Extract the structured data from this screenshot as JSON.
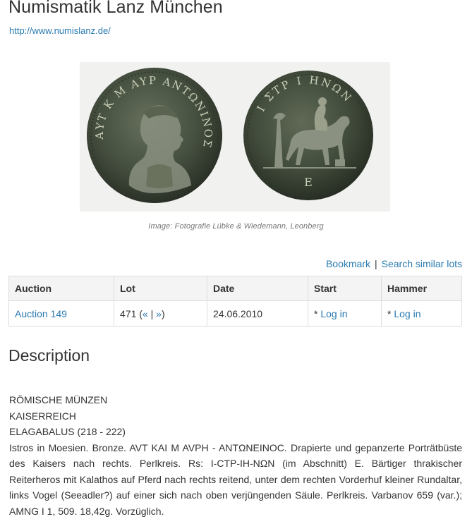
{
  "header": {
    "title": "Numismatik Lanz München",
    "site_url": "http://www.numislanz.de/"
  },
  "image": {
    "obverse_legend": "ΑΥΤ Κ Μ ΑΥΡ ΑΝΤΩΝΙΝΟΣ",
    "reverse_legend": "Ι ΣΤΡ Ι ΗΝΩΝ",
    "exergue": "Ε",
    "caption": "Image: Fotografie Lübke & Wiedemann, Leonberg"
  },
  "actions": {
    "bookmark": "Bookmark",
    "separator": "|",
    "search_similar": "Search similar lots"
  },
  "table": {
    "headers": [
      "Auction",
      "Lot",
      "Date",
      "Start",
      "Hammer"
    ],
    "row": {
      "auction": "Auction 149",
      "lot_number": "471",
      "lot_open": "(",
      "lot_prev": "«",
      "lot_sep": "|",
      "lot_next": "»",
      "lot_close": ")",
      "date": "24.06.2010",
      "start_prefix": "*",
      "start_login": "Log in",
      "hammer_prefix": "*",
      "hammer_login": "Log in"
    }
  },
  "description": {
    "heading": "Description",
    "lines": [
      "RÖMISCHE MÜNZEN",
      "KAISERREICH",
      "ELAGABALUS (218 - 222)"
    ],
    "body": "Istros in Moesien. Bronze. AVT KAI M AVPH - ANTΩNEINOC. Drapierte und gepanzerte Porträtbüste des Kaisers nach rechts. Perlkreis. Rs: I-CTP-IH-NΩN (im Abschnitt) E. Bärtiger thrakischer Reiterheros mit Kalathos auf Pferd nach rechts reitend, unter dem rechten Vorderhuf kleiner Rundaltar, links Vogel (Seeadler?) auf einer sich nach oben verjüngenden Säule. Perlkreis. Varbanov 659 (var.); AMNG I 1, 509. 18,42g. Vorzüglich."
  },
  "colors": {
    "link": "#2a7ab0",
    "coin_patina": "#3f4a3a",
    "table_header_bg": "#f4f4f4"
  }
}
